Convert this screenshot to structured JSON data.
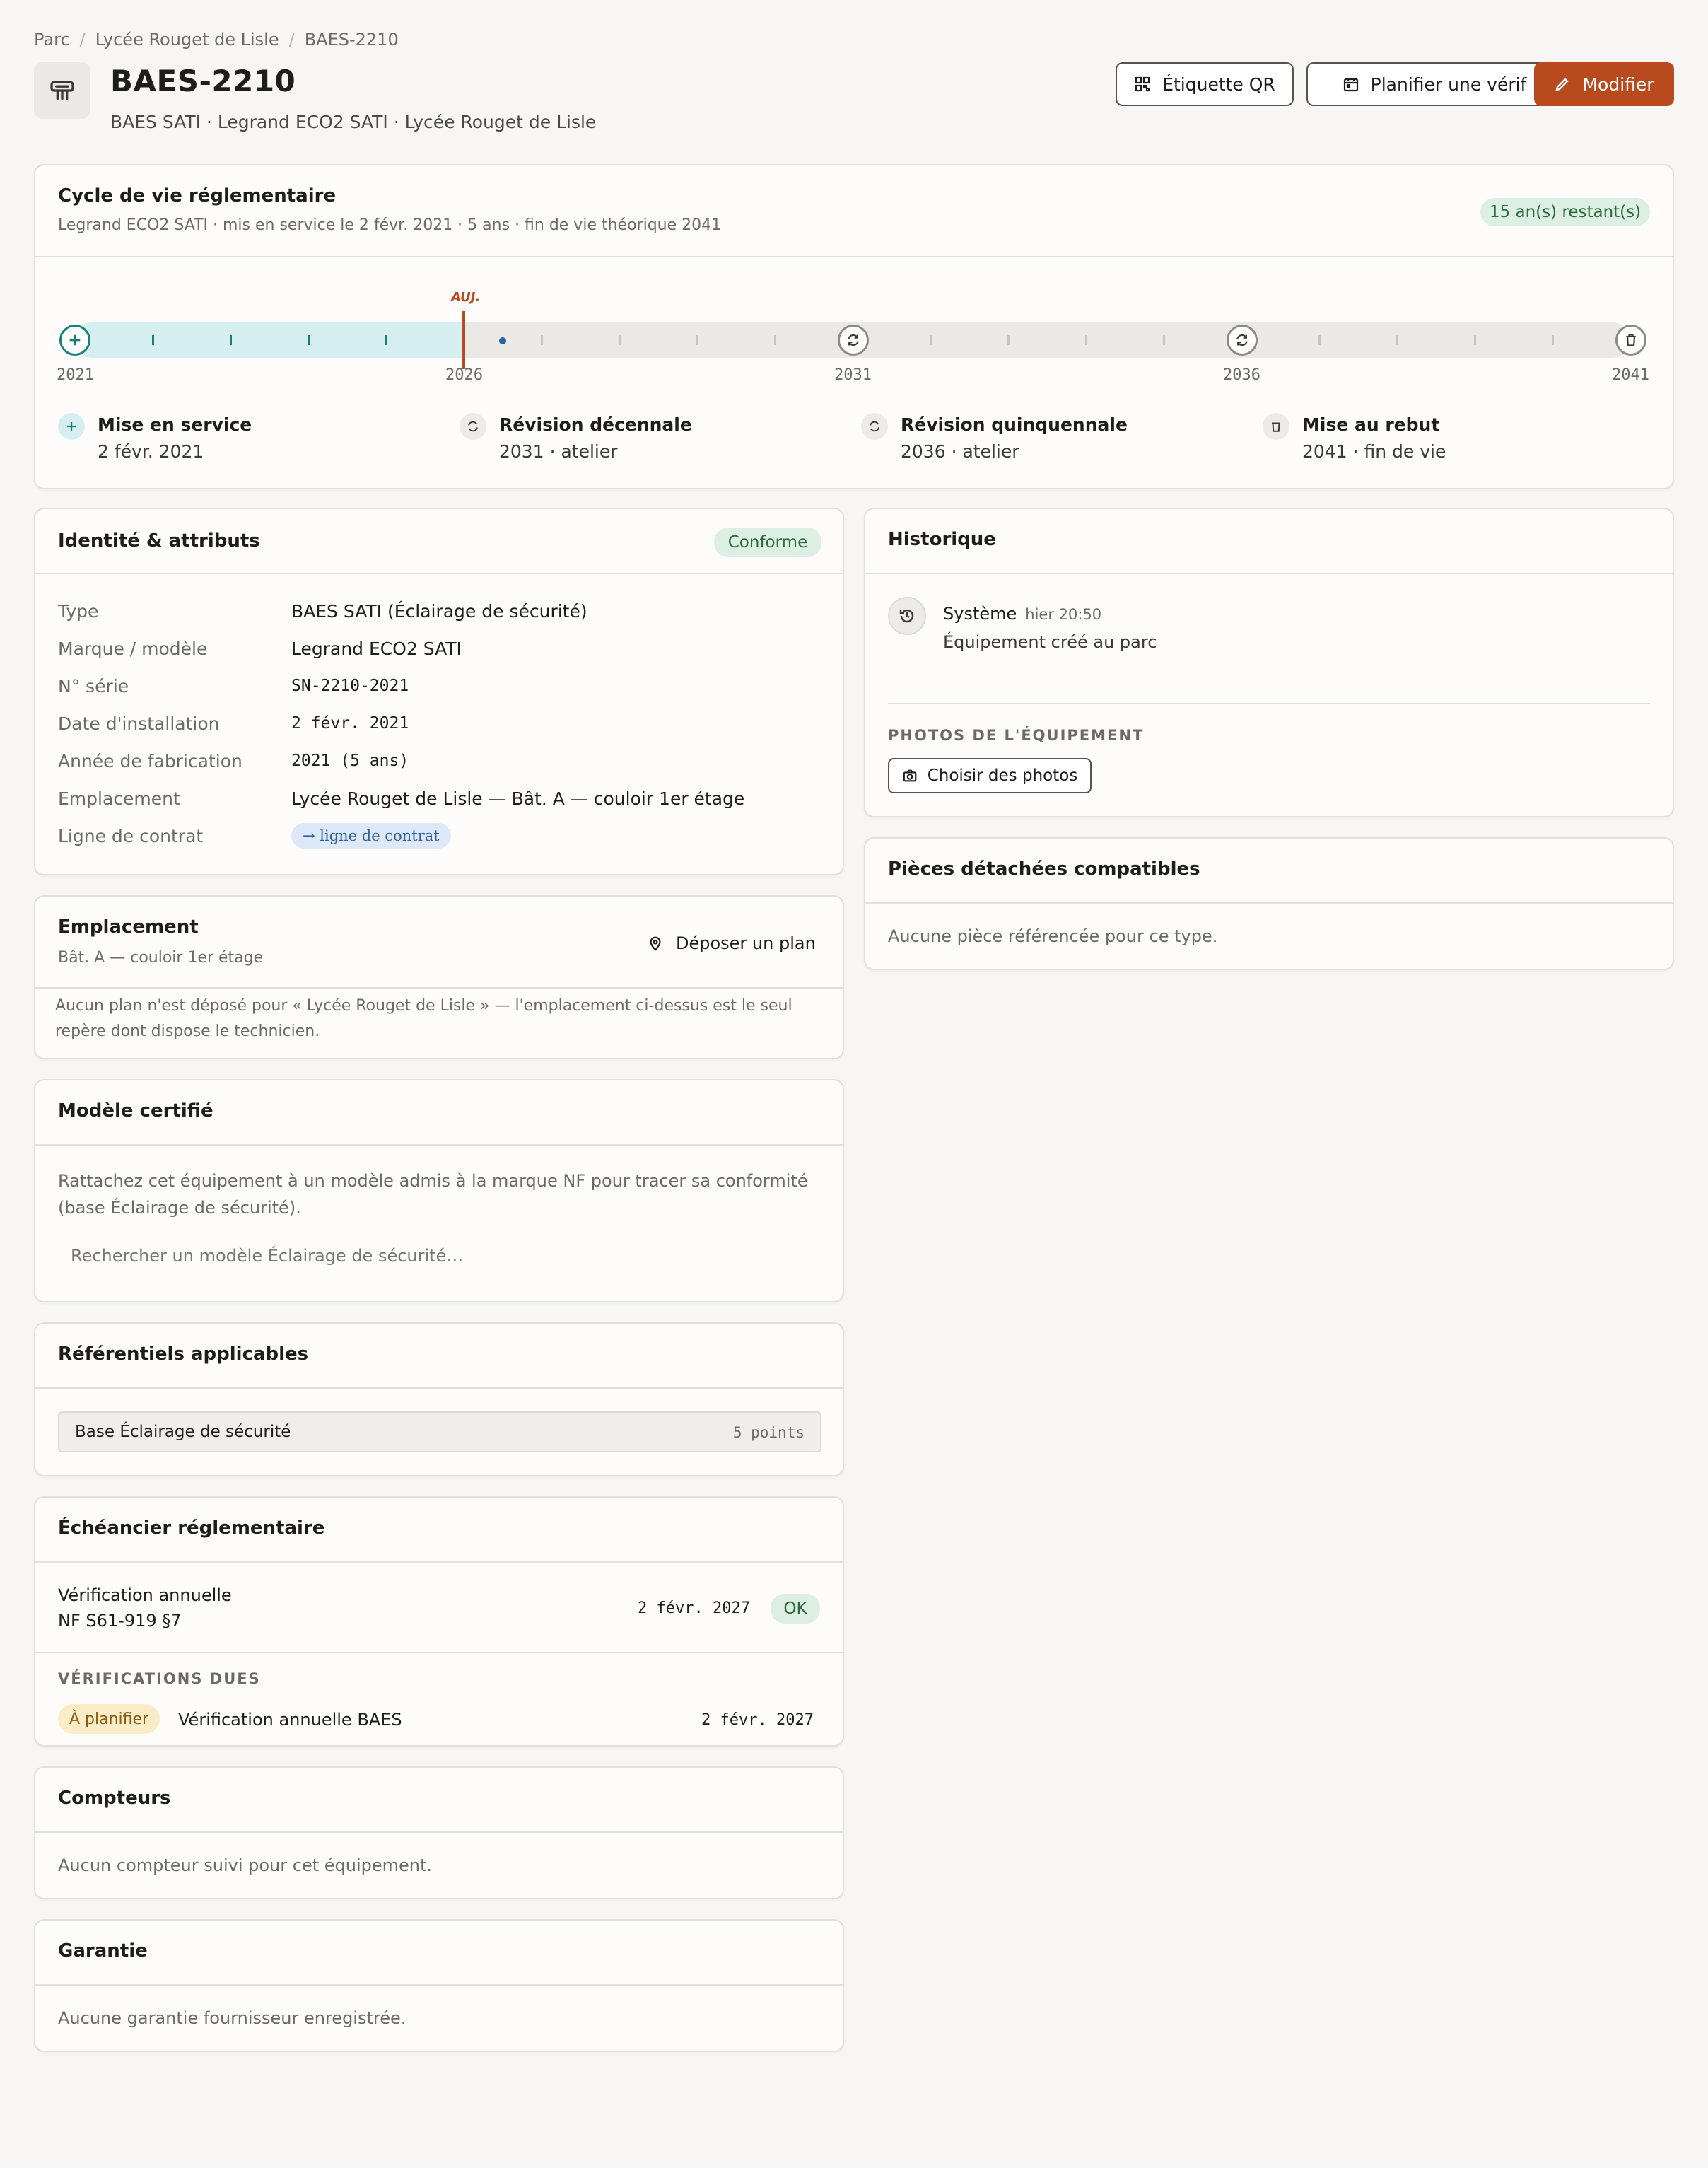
{
  "breadcrumb": {
    "items": [
      "Parc",
      "Lycée Rouget de Lisle",
      "BAES-2210"
    ],
    "separator": "/"
  },
  "header": {
    "title": "BAES-2210",
    "subtitle": "BAES SATI · Legrand ECO2 SATI · Lycée Rouget de Lisle",
    "icon": "emergency-light-icon"
  },
  "actions": {
    "qr_label": "Étiquette QR",
    "schedule_label": "Planifier une vérif",
    "edit_label": "Modifier"
  },
  "colors": {
    "accent": "#b84a1e",
    "teal": "#17807a",
    "success_bg": "#dcefe2",
    "success_fg": "#2b6a3e",
    "warn_bg": "#fbecc8",
    "warn_fg": "#8a5a12"
  },
  "lifecycle": {
    "title": "Cycle de vie réglementaire",
    "subtitle": "Legrand ECO2 SATI · mis en service le 2 févr. 2021 · 5 ans · fin de vie théorique 2041",
    "badge": "15 an(s) restant(s)",
    "today_label": "AUJ.",
    "start_year": 2021,
    "end_year": 2041,
    "today_fraction": 0.25,
    "axis_years": [
      "2021",
      "2026",
      "2031",
      "2036",
      "2041"
    ],
    "milestones": [
      {
        "title": "Mise en service",
        "sub": "2 févr. 2021",
        "icon": "plus-icon"
      },
      {
        "title": "Révision décennale",
        "sub": "2031 · atelier",
        "icon": "revision-icon"
      },
      {
        "title": "Révision quinquennale",
        "sub": "2036 · atelier",
        "icon": "revision-icon"
      },
      {
        "title": "Mise au rebut",
        "sub": "2041 · fin de vie",
        "icon": "trash-icon"
      }
    ]
  },
  "identity": {
    "title": "Identité & attributs",
    "badge": "Conforme",
    "rows": [
      {
        "label": "Type",
        "value": "BAES SATI (Éclairage de sécurité)"
      },
      {
        "label": "Marque / modèle",
        "value": "Legrand ECO2 SATI"
      },
      {
        "label": "N° série",
        "value": "SN-2210-2021"
      },
      {
        "label": "Date d'installation",
        "value": "2 févr. 2021"
      },
      {
        "label": "Année de fabrication",
        "value": "2021 (5 ans)"
      },
      {
        "label": "Emplacement",
        "value": "Lycée Rouget de Lisle — Bât. A — couloir 1er étage"
      },
      {
        "label": "Ligne de contrat",
        "value": "→ ligne de contrat"
      }
    ]
  },
  "location": {
    "title": "Emplacement",
    "sub": "Bât. A — couloir 1er étage",
    "plan_label": "Déposer un plan",
    "note": "Aucun plan n'est déposé pour « Lycée Rouget de Lisle » — l'emplacement ci-dessus est le seul repère dont dispose le technicien.",
    "note_line1": "Aucun plan n'est déposé pour « Lycée Rouget de Lisle » — l'emplacement ci-dessus est le seul",
    "note_line2": "repère dont dispose le technicien."
  },
  "certified": {
    "title": "Modèle certifié",
    "text_line1": "Rattachez cet équipement à un modèle admis à la marque NF pour tracer sa conformité",
    "text_line2": "(base Éclairage de sécurité).",
    "search_placeholder": "Rechercher un modèle Éclairage de sécurité…"
  },
  "refs": {
    "title": "Référentiels applicables",
    "item": "Base Éclairage de sécurité",
    "points": "5 points"
  },
  "schedule": {
    "title": "Échéancier réglementaire",
    "line1": "Vérification annuelle",
    "line2": "NF S61-919 §7",
    "date": "2 févr. 2027",
    "status": "OK",
    "due_title": "VÉRIFICATIONS DUES",
    "due_badge": "À planifier",
    "due_label": "Vérification annuelle BAES",
    "due_date": "2 févr. 2027"
  },
  "counters": {
    "title": "Compteurs",
    "text": "Aucun compteur suivi pour cet équipement."
  },
  "warranty": {
    "title": "Garantie",
    "text": "Aucune garantie fournisseur enregistrée."
  },
  "history": {
    "title": "Historique",
    "author": "Système",
    "time": "hier 20:50",
    "event": "Équipement créé au parc",
    "photos_title": "PHOTOS DE L'ÉQUIPEMENT",
    "photos_button": "Choisir des photos"
  },
  "parts": {
    "title": "Pièces détachées compatibles",
    "text": "Aucune pièce référencée pour ce type."
  }
}
